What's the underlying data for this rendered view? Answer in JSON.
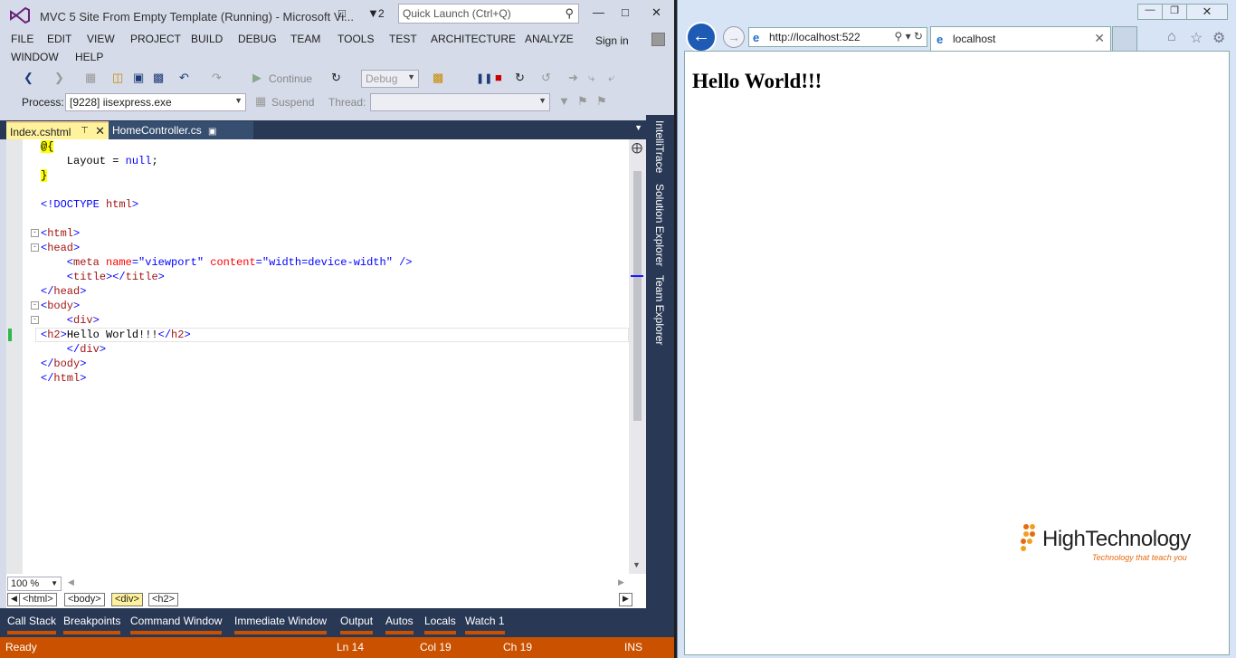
{
  "vs": {
    "title": "MVC 5 Site From Empty Template (Running) - Microsoft Vi...",
    "notif_count": "2",
    "quick_launch_placeholder": "Quick Launch (Ctrl+Q)",
    "menu": [
      "FILE",
      "EDIT",
      "VIEW",
      "PROJECT",
      "BUILD",
      "DEBUG",
      "TEAM",
      "TOOLS",
      "TEST",
      "ARCHITECTURE",
      "ANALYZE",
      "WINDOW",
      "HELP"
    ],
    "sign_in": "Sign in",
    "toolbar": {
      "continue_label": "Continue",
      "config_value": "Debug",
      "process_label": "Process:",
      "process_value": "[9228] iisexpress.exe",
      "suspend_label": "Suspend",
      "thread_label": "Thread:"
    },
    "tabs": [
      {
        "label": "Index.cshtml"
      },
      {
        "label": "HomeController.cs"
      }
    ],
    "code": {
      "l1": "@{",
      "l2a": "    Layout = ",
      "l2b": "null",
      "l2c": ";",
      "l3": "}",
      "l5a": "<!DOCTYPE ",
      "l5b": "html",
      "l5c": ">",
      "l7a": "<",
      "l7b": "html",
      "l7c": ">",
      "l8a": "<",
      "l8b": "head",
      "l8c": ">",
      "l9a": "    <",
      "l9b": "meta",
      "l9c": " name",
      "l9d": "=\"viewport\"",
      "l9e": " content",
      "l9f": "=\"width=device-width\"",
      "l9g": " />",
      "l10a": "    <",
      "l10b": "title",
      "l10c": "></",
      "l10d": "title",
      "l10e": ">",
      "l11a": "</",
      "l11b": "head",
      "l11c": ">",
      "l12a": "<",
      "l12b": "body",
      "l12c": ">",
      "l13a": "    <",
      "l13b": "div",
      "l13c": ">",
      "l14a": "<",
      "l14b": "h2",
      "l14c": ">",
      "l14d": "Hello World!!!",
      "l14e": "</",
      "l14f": "h2",
      "l14g": ">",
      "l15a": "    </",
      "l15b": "div",
      "l15c": ">",
      "l16a": "</",
      "l16b": "body",
      "l16c": ">",
      "l17a": "</",
      "l17b": "html",
      "l17c": ">"
    },
    "zoom": "100 %",
    "breadcrumbs": [
      "<html>",
      "<body>",
      "<div>",
      "<h2>"
    ],
    "side_tabs": [
      "IntelliTrace",
      "Solution Explorer",
      "Team Explorer"
    ],
    "debug_tabs": [
      "Call Stack",
      "Breakpoints",
      "Command Window",
      "Immediate Window",
      "Output",
      "Autos",
      "Locals",
      "Watch 1"
    ],
    "status": {
      "ready": "Ready",
      "ln": "Ln 14",
      "col": "Col 19",
      "ch": "Ch 19",
      "mode": "INS"
    }
  },
  "ie": {
    "address": "http://localhost:522",
    "tab_title": "localhost",
    "content_heading": "Hello World!!!",
    "logo_text": "HighTechnology",
    "logo_tagline": "Technology that teach you",
    "colors": {
      "back_button": "#1e5bb5",
      "status_bar": "#ca5100",
      "logo_accent": "#e86a10"
    }
  }
}
